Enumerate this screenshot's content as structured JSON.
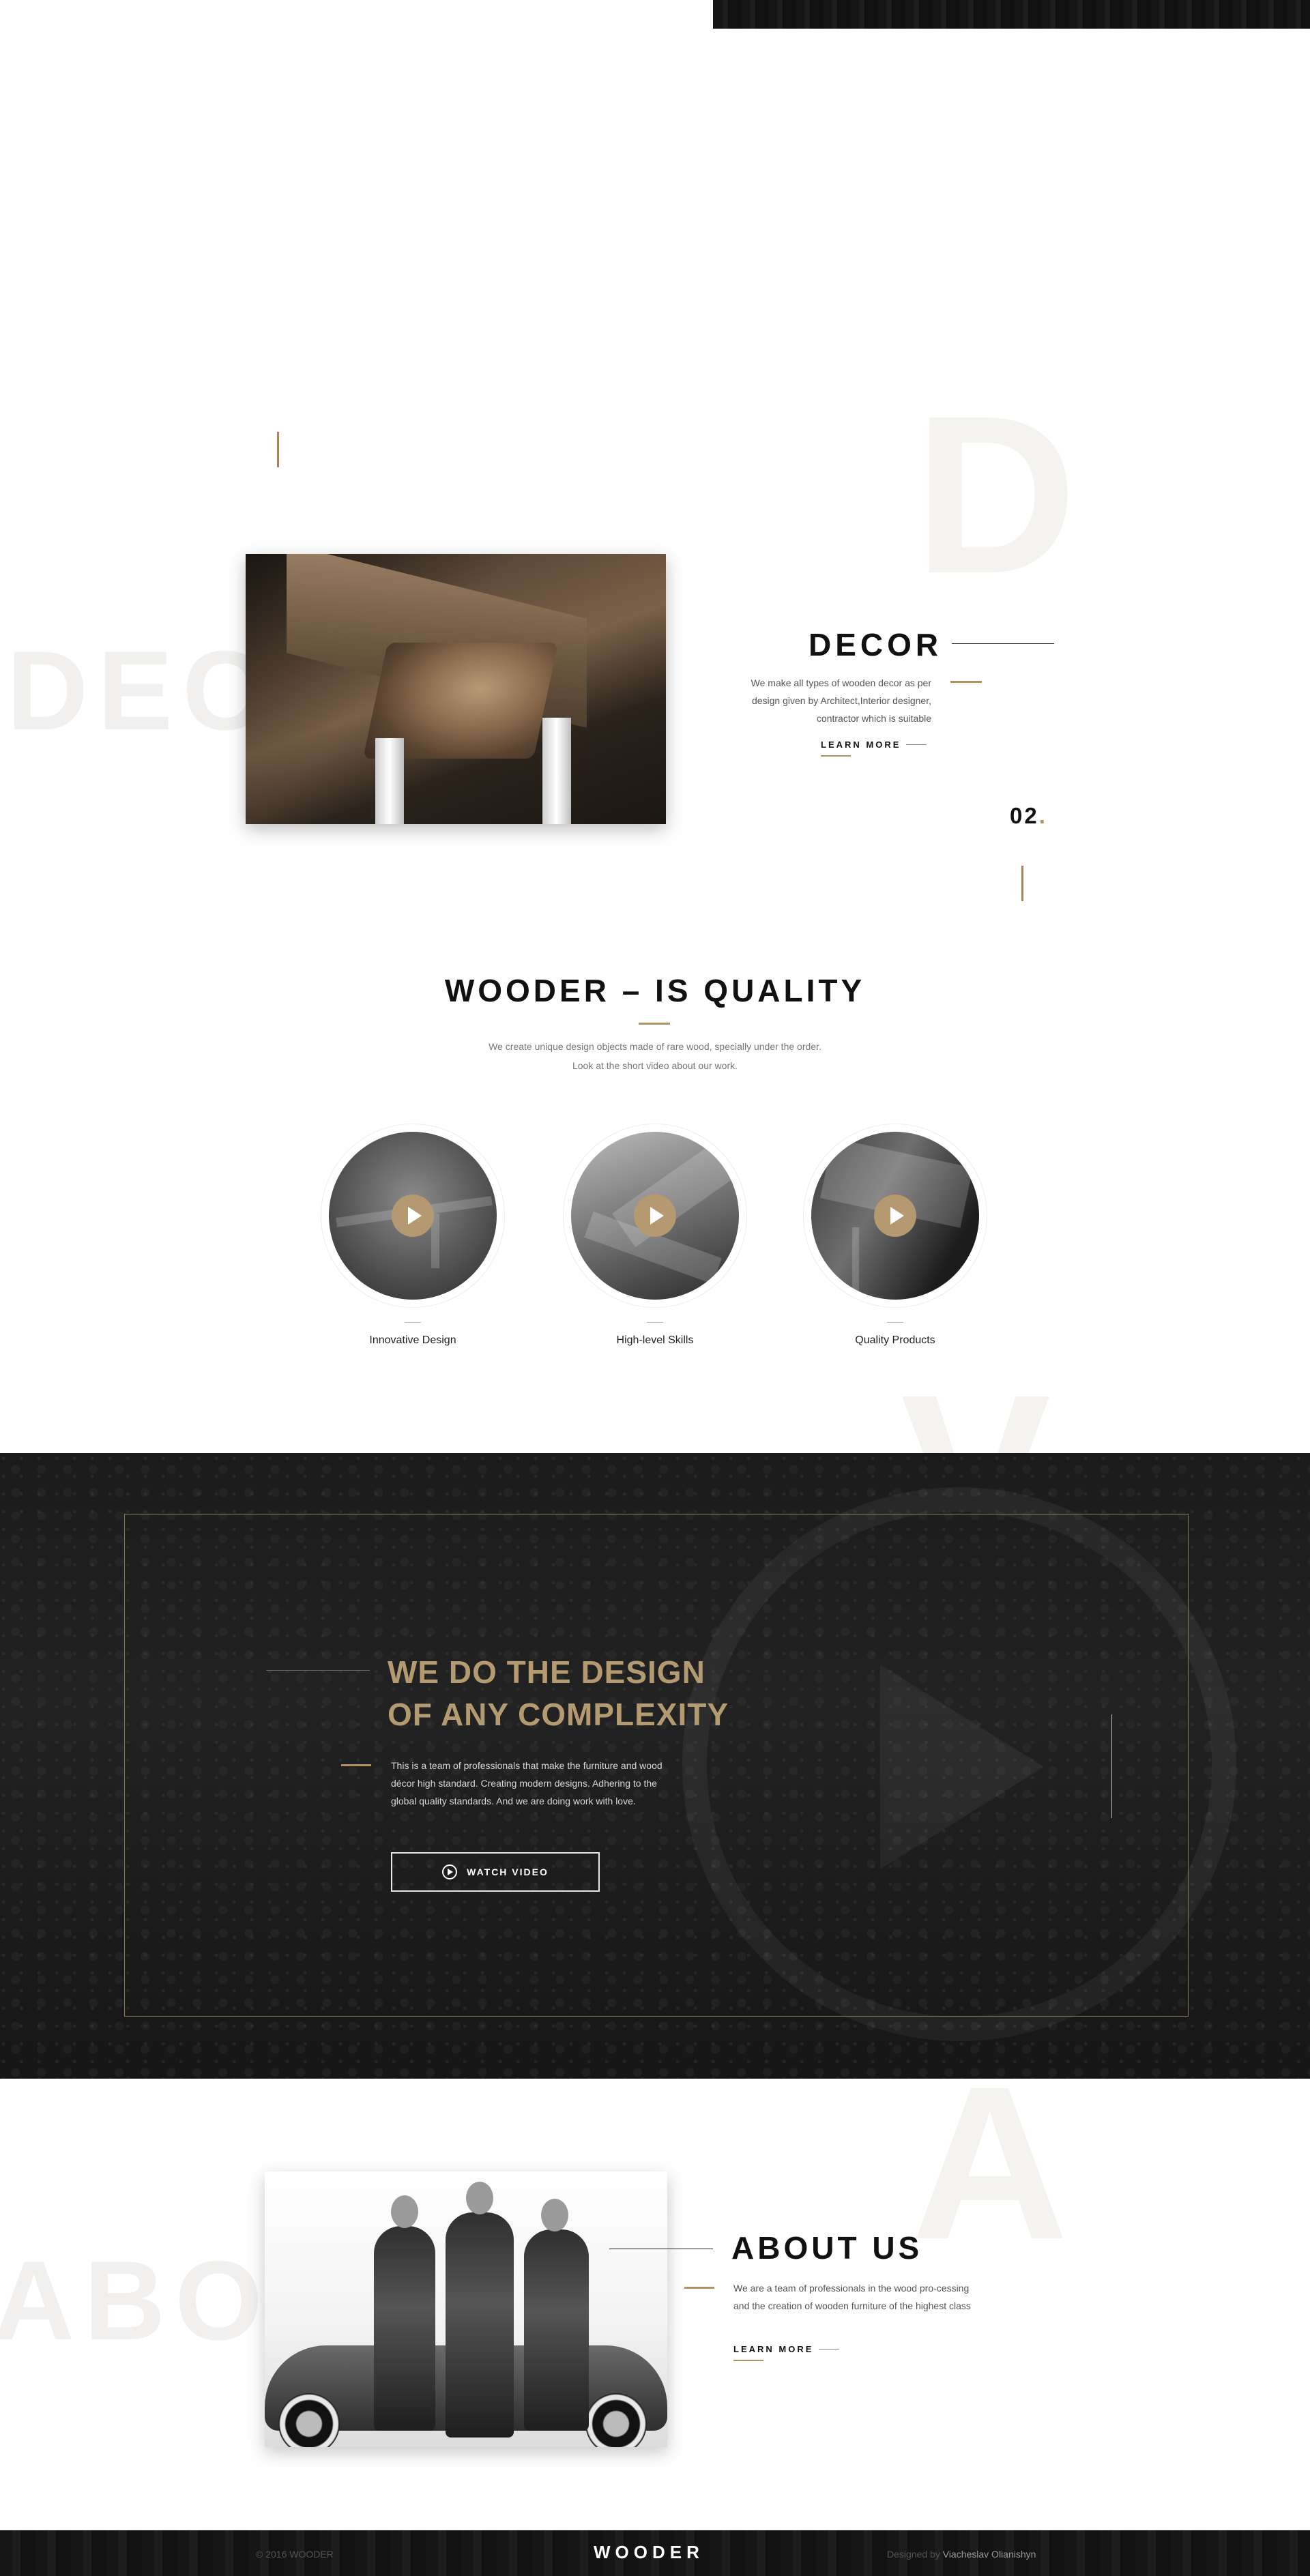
{
  "ghost_letters": {
    "decor_initial": "D",
    "decor_word": "DECOR",
    "video_initial": "V",
    "about_initial": "A",
    "about_word": "ABOUT"
  },
  "decor": {
    "title": "DECOR",
    "text": "We make all types of wooden decor as per design given by Architect,Interior designer, contractor which is suitable",
    "learn_more": "LEARN MORE",
    "number": "02",
    "number_dot": "."
  },
  "quality": {
    "title": "WOODER – IS QUALITY",
    "text_line1": "We create unique design objects made of rare wood, specially under the order.",
    "text_line2": "Look at the short video about our work.",
    "items": [
      {
        "label": "Innovative Design",
        "icon": "play-icon"
      },
      {
        "label": "High-level Skills",
        "icon": "play-icon"
      },
      {
        "label": "Quality Products",
        "icon": "play-icon"
      }
    ]
  },
  "video_section": {
    "title_line1": "WE DO THE DESIGN",
    "title_line2": "OF ANY COMPLEXITY",
    "text": "This is a team of professionals that make the furniture and wood décor high standard. Creating modern designs. Adhering to the global quality standards. And we are doing work with love.",
    "button_label": "WATCH VIDEO"
  },
  "about": {
    "title": "ABOUT US",
    "text": "We are a team of professionals in the wood pro-cessing and the creation of wooden furniture of the highest class",
    "learn_more": "LEARN MORE"
  },
  "footer": {
    "copyright": "© 2016 WOODER",
    "logo": "WOODER",
    "designed_prefix": "Designed by",
    "designer": "Viacheslav Olianishyn"
  },
  "colors": {
    "gold": "#b58f5e",
    "heading_gold": "#b39a70",
    "dark_bg": "#1b1b1b"
  }
}
